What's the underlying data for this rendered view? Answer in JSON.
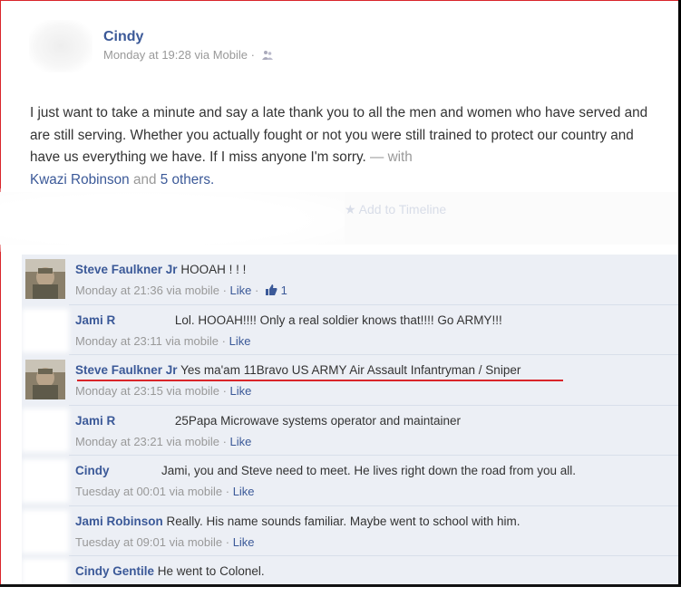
{
  "post": {
    "author": "Cindy",
    "timestamp": "Monday at 19:28 via Mobile",
    "separator": "·",
    "text_main": "I just want to take a minute and say a late thank you to all the men and women who have served and are still serving. Whether you actually fought or not you were still trained to protect our country and have us everything we have. If I miss anyone I'm sorry.",
    "with_prefix": "— with",
    "tagged_name": "Kwazi Robinson",
    "and_word": "and",
    "others_link": "5 others.",
    "add_to_timeline": "Add to Timeline"
  },
  "comments": [
    {
      "name": "Steve Faulkner Jr",
      "text": "HOOAH ! ! !",
      "meta": "Monday at 21:36 via mobile",
      "like": "Like",
      "like_count": "1"
    },
    {
      "name": "Jami R",
      "text": "Lol. HOOAH!!!! Only a real soldier knows that!!!! Go ARMY!!!",
      "meta": "Monday at 23:11 via mobile",
      "like": "Like"
    },
    {
      "name": "Steve Faulkner Jr",
      "text": "Yes ma'am 11Bravo US ARMY Air Assault Infantryman / Sniper",
      "meta": "Monday at 23:15 via mobile",
      "like": "Like"
    },
    {
      "name": "Jami R",
      "text": "25Papa Microwave systems operator and maintainer",
      "meta": "Monday at 23:21 via mobile",
      "like": "Like"
    },
    {
      "name": "Cindy",
      "text": "Jami, you and Steve need to meet. He lives right down the road from you all.",
      "meta": "Tuesday at 00:01 via mobile",
      "like": "Like"
    },
    {
      "name": "Jami Robinson",
      "text": "Really. His name sounds familiar. Maybe went to school with him.",
      "meta": "Tuesday at 09:01 via mobile",
      "like": "Like"
    },
    {
      "name": "Cindy Gentile",
      "text": "He went to Colonel."
    }
  ],
  "colors": {
    "link": "#3b5998",
    "comment_bg": "#eceff5",
    "highlight": "#d9252a"
  },
  "icons": [
    "audience-icon",
    "thumbs-up-icon",
    "avatar-photo"
  ]
}
